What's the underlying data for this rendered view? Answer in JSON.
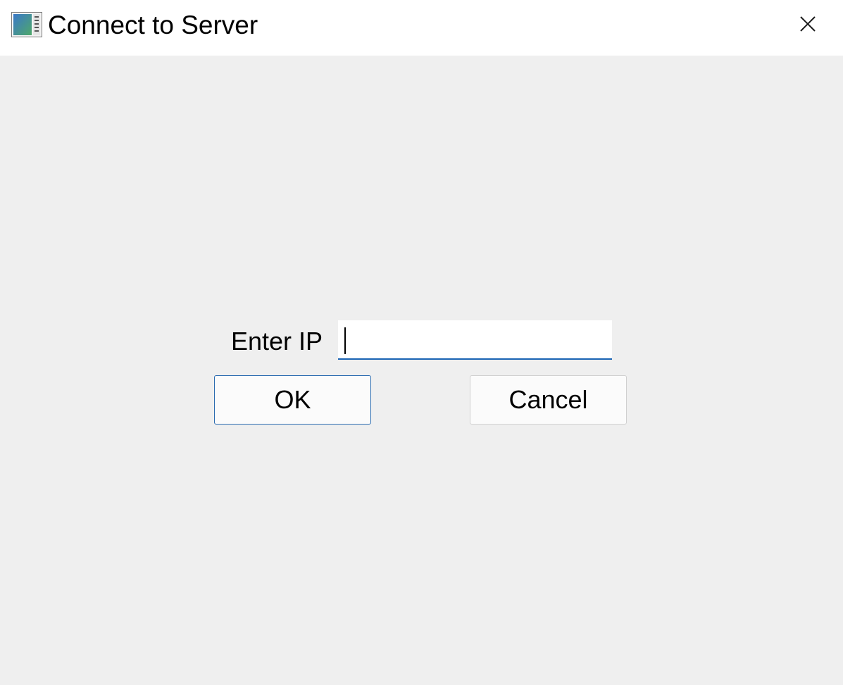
{
  "window": {
    "title": "Connect to Server",
    "icon": "app-window-icon",
    "close_icon": "close-icon"
  },
  "form": {
    "ip_label": "Enter IP",
    "ip_value": "",
    "ok_label": "OK",
    "cancel_label": "Cancel"
  },
  "colors": {
    "titlebar_bg": "#ffffff",
    "client_bg": "#efefef",
    "focus_accent": "#1a64b4",
    "default_button_border": "#2b6cb0"
  }
}
